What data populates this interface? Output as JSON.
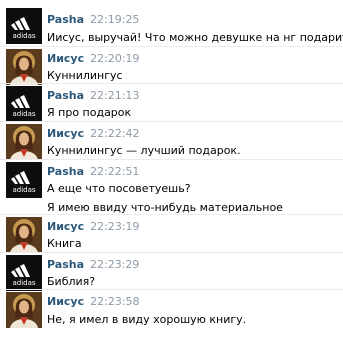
{
  "messages": [
    {
      "author": "Pasha",
      "time": "22:19:25",
      "avatar": "adidas-logo",
      "lines": [
        "Иисус, выручай! Что можно девушке на нг подарит?"
      ]
    },
    {
      "author": "Иисус",
      "time": "22:20:19",
      "avatar": "jesus-portrait",
      "lines": [
        "Куннилингус"
      ]
    },
    {
      "author": "Pasha",
      "time": "22:21:13",
      "avatar": "adidas-logo",
      "lines": [
        "Я про подарок"
      ]
    },
    {
      "author": "Иисус",
      "time": "22:22:42",
      "avatar": "jesus-portrait",
      "lines": [
        "Куннилингус — лучший подарок."
      ]
    },
    {
      "author": "Pasha",
      "time": "22:22:51",
      "avatar": "adidas-logo",
      "lines": [
        "А еще что посоветуешь?",
        "Я имею ввиду что-нибудь материальное"
      ]
    },
    {
      "author": "Иисус",
      "time": "22:23:19",
      "avatar": "jesus-portrait",
      "lines": [
        "Книга"
      ]
    },
    {
      "author": "Pasha",
      "time": "22:23:29",
      "avatar": "adidas-logo",
      "lines": [
        "Библия?"
      ]
    },
    {
      "author": "Иисус",
      "time": "22:23:58",
      "avatar": "jesus-portrait",
      "lines": [
        "Не, я имел в виду хорошую книгу."
      ]
    }
  ],
  "logo_text": "adidas",
  "colors": {
    "author": "#2b587a",
    "time": "#8c9aa8",
    "separator": "#e9edf1"
  }
}
